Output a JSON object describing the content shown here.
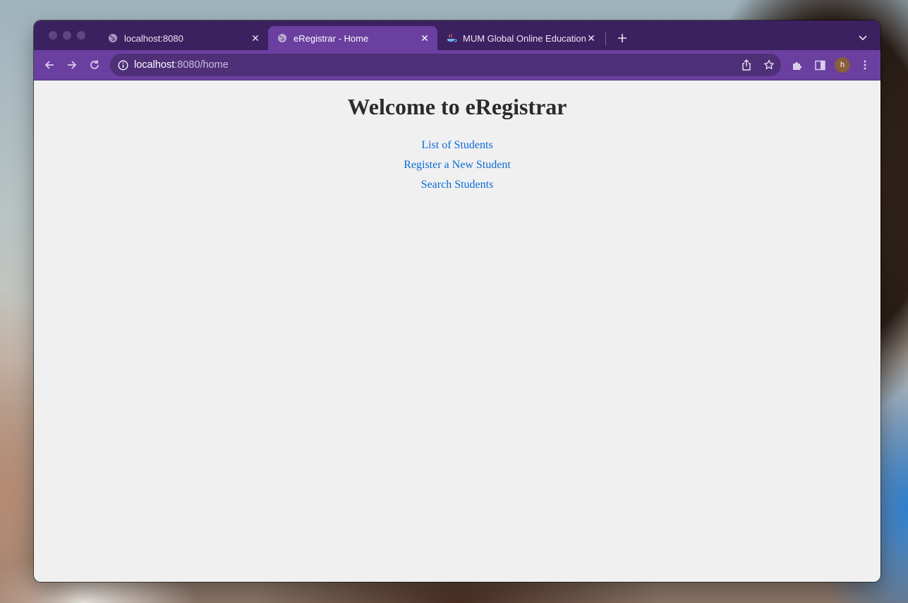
{
  "browser": {
    "tabs": [
      {
        "title": "localhost:8080",
        "active": false,
        "favicon": "globe-icon"
      },
      {
        "title": "eRegistrar - Home",
        "active": true,
        "favicon": "globe-icon"
      },
      {
        "title": "MUM Global Online Education",
        "active": false,
        "favicon": "coffee-cup-icon"
      }
    ],
    "url": {
      "host": "localhost",
      "rest": ":8080/home"
    },
    "profile_initial": "h",
    "colors": {
      "frame": "#3c2160",
      "toolbar": "#6a3fa0",
      "omnibox": "#4e2f78"
    }
  },
  "page": {
    "heading": "Welcome to eRegistrar",
    "links": [
      {
        "label": "List of Students"
      },
      {
        "label": "Register a New Student"
      },
      {
        "label": "Search Students"
      }
    ],
    "link_color": "#0a6ad6"
  }
}
